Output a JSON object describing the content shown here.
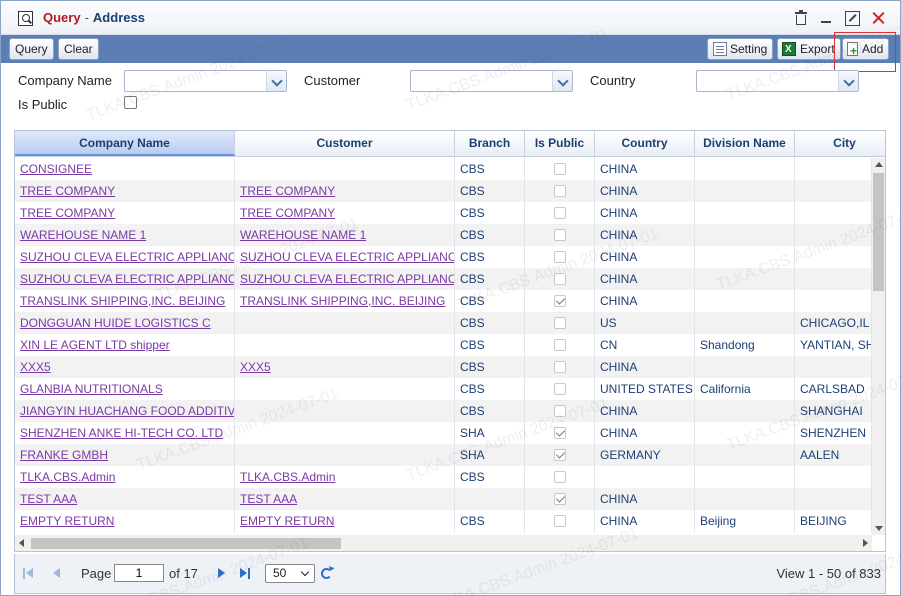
{
  "window": {
    "title": "Query",
    "title_separator": "-",
    "subtitle": "Address"
  },
  "toolbar": {
    "query_label": "Query",
    "clear_label": "Clear",
    "setting_label": "Setting",
    "export_label": "Export",
    "add_label": "Add"
  },
  "filters": {
    "company_name_label": "Company Name",
    "company_name_value": "",
    "customer_label": "Customer",
    "customer_value": "",
    "country_label": "Country",
    "country_value": "",
    "is_public_label": "Is Public",
    "is_public_checked": false
  },
  "grid": {
    "columns": [
      "Company Name",
      "Customer",
      "Branch",
      "Is Public",
      "Country",
      "Division Name",
      "City"
    ],
    "rows": [
      {
        "company": "CONSIGNEE",
        "customer": "",
        "branch": "CBS",
        "is_public": false,
        "country": "CHINA",
        "division": "",
        "city": ""
      },
      {
        "company": "TREE COMPANY",
        "customer": "TREE COMPANY",
        "branch": "CBS",
        "is_public": false,
        "country": "CHINA",
        "division": "",
        "city": ""
      },
      {
        "company": "TREE COMPANY",
        "customer": "TREE COMPANY",
        "branch": "CBS",
        "is_public": false,
        "country": "CHINA",
        "division": "",
        "city": ""
      },
      {
        "company": "WAREHOUSE NAME 1",
        "customer": "WAREHOUSE NAME 1",
        "branch": "CBS",
        "is_public": false,
        "country": "CHINA",
        "division": "",
        "city": ""
      },
      {
        "company": "SUZHOU CLEVA ELECTRIC APPLIANC",
        "customer": "SUZHOU CLEVA ELECTRIC APPLIANC",
        "branch": "CBS",
        "is_public": false,
        "country": "CHINA",
        "division": "",
        "city": ""
      },
      {
        "company": "SUZHOU CLEVA ELECTRIC APPLIANC",
        "customer": "SUZHOU CLEVA ELECTRIC APPLIANC",
        "branch": "CBS",
        "is_public": false,
        "country": "CHINA",
        "division": "",
        "city": ""
      },
      {
        "company": "TRANSLINK SHIPPING,INC. BEIJING",
        "customer": "TRANSLINK SHIPPING,INC. BEIJING",
        "branch": "CBS",
        "is_public": true,
        "country": "CHINA",
        "division": "",
        "city": ""
      },
      {
        "company": "DONGGUAN HUIDE LOGISTICS C",
        "customer": "",
        "branch": "CBS",
        "is_public": false,
        "country": "US",
        "division": "",
        "city": "CHICAGO,IL"
      },
      {
        "company": "XIN LE AGENT LTD shipper",
        "customer": "",
        "branch": "CBS",
        "is_public": false,
        "country": "CN",
        "division": "Shandong",
        "city": "YANTIAN, SH"
      },
      {
        "company": "XXX5",
        "customer": "XXX5",
        "branch": "CBS",
        "is_public": false,
        "country": "CHINA",
        "division": "",
        "city": ""
      },
      {
        "company": "GLANBIA NUTRITIONALS",
        "customer": "",
        "branch": "CBS",
        "is_public": false,
        "country": "UNITED STATES",
        "division": "California",
        "city": "CARLSBAD"
      },
      {
        "company": "JIANGYIN HUACHANG FOOD ADDITIV",
        "customer": "",
        "branch": "CBS",
        "is_public": false,
        "country": "CHINA",
        "division": "",
        "city": "SHANGHAI"
      },
      {
        "company": "SHENZHEN ANKE HI-TECH CO. LTD",
        "customer": "",
        "branch": "SHA",
        "is_public": true,
        "country": "CHINA",
        "division": "",
        "city": "SHENZHEN"
      },
      {
        "company": "FRANKE GMBH",
        "customer": "",
        "branch": "SHA",
        "is_public": true,
        "country": "GERMANY",
        "division": "",
        "city": "AALEN"
      },
      {
        "company": "TLKA.CBS.Admin",
        "customer": "TLKA.CBS.Admin",
        "branch": "CBS",
        "is_public": false,
        "country": "",
        "division": "",
        "city": ""
      },
      {
        "company": "TEST AAA",
        "customer": "TEST AAA",
        "branch": "",
        "is_public": true,
        "country": "CHINA",
        "division": "",
        "city": ""
      },
      {
        "company": "EMPTY RETURN",
        "customer": "EMPTY RETURN",
        "branch": "CBS",
        "is_public": false,
        "country": "CHINA",
        "division": "Beijing",
        "city": "BEIJING"
      }
    ]
  },
  "pager": {
    "page_label": "Page",
    "page_value": "1",
    "of_label": "of 17",
    "page_size": "50",
    "view_text": "View 1 - 50 of 833"
  },
  "watermark": {
    "text": "TLKA.CBS.Admin 2024-07-01"
  },
  "colors": {
    "toolbar_bg": "#5b7fb4",
    "title_accent": "#b01c1c",
    "title_subtitle": "#1c3f73",
    "link": "#7a3aa6",
    "highlight_box": "#e23030"
  }
}
